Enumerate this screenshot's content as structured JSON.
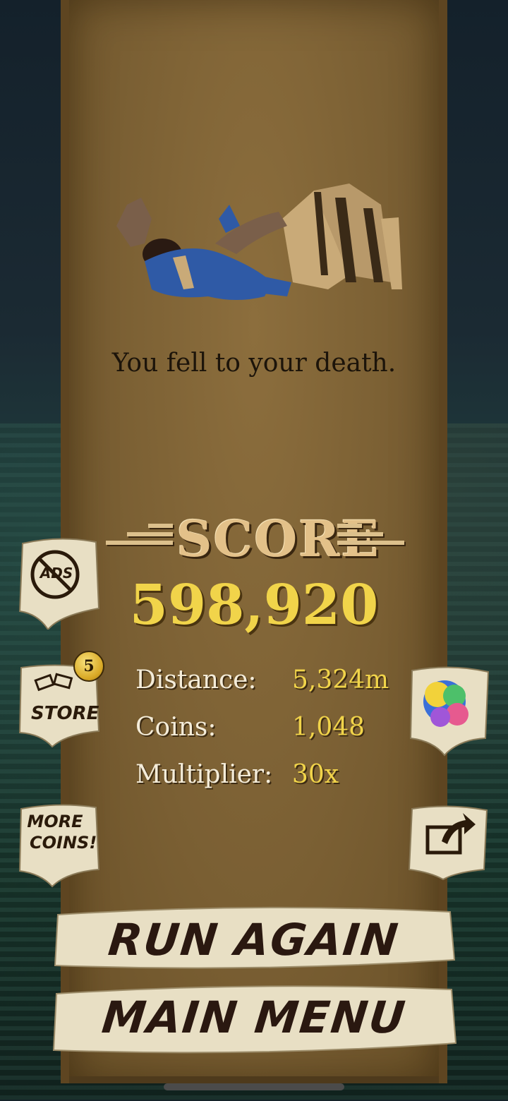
{
  "game_over": {
    "message": "You fell to your death."
  },
  "score": {
    "heading": "SCORE",
    "value": "598,920"
  },
  "stats": [
    {
      "label": "Distance:",
      "value": "5,324m"
    },
    {
      "label": "Coins:",
      "value": "1,048"
    },
    {
      "label": "Multiplier:",
      "value": "30x"
    }
  ],
  "side_buttons": {
    "ads_label": "ADS",
    "store_label": "STORE",
    "store_badge": "5",
    "more_coins_line1": "MORE",
    "more_coins_line2": "COINS!",
    "gems_icon": "gems-icon",
    "share_icon": "share-icon"
  },
  "actions": {
    "run_again": "RUN AGAIN",
    "main_menu": "MAIN MENU"
  },
  "colors": {
    "score_yellow": "#f1d44a",
    "panel_brown": "#7a5f33",
    "parchment": "#e8dfc4"
  }
}
